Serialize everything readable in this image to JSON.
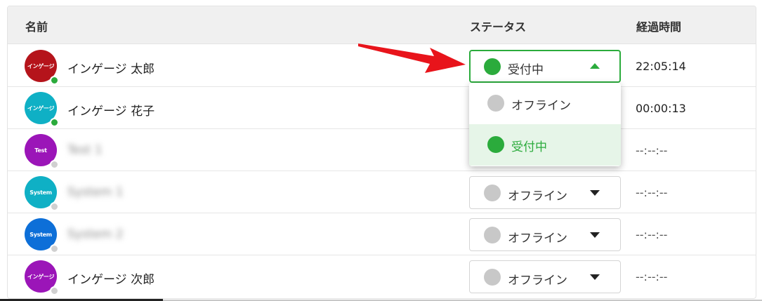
{
  "colors": {
    "online": "#2bab3c",
    "offline": "#c8c8c8",
    "header_bg": "#f0f0f0"
  },
  "table": {
    "headers": {
      "name": "名前",
      "status": "ステータス",
      "elapsed": "経過時間"
    },
    "rows": [
      {
        "avatar_text": "インゲージ",
        "avatar_color": "#b5141b",
        "online": true,
        "name": "インゲージ 太郎",
        "status": "受付中",
        "elapsed": "22:05:14"
      },
      {
        "avatar_text": "インゲージ",
        "avatar_color": "#0fb0c5",
        "online": true,
        "name": "インゲージ 花子",
        "status": "",
        "elapsed": "00:00:13"
      },
      {
        "avatar_text": "Test",
        "avatar_color": "#9b15b8",
        "online": false,
        "name": "Test 1",
        "status": "",
        "elapsed": "--:--:--"
      },
      {
        "avatar_text": "System",
        "avatar_color": "#0fb0c5",
        "online": false,
        "name": "System 1",
        "status": "オフライン",
        "elapsed": "--:--:--"
      },
      {
        "avatar_text": "System",
        "avatar_color": "#0d6fd8",
        "online": false,
        "name": "System 2",
        "status": "オフライン",
        "elapsed": "--:--:--"
      },
      {
        "avatar_text": "インゲージ",
        "avatar_color": "#9b15b8",
        "online": false,
        "name": "インゲージ 次郎",
        "status": "オフライン",
        "elapsed": "--:--:--"
      }
    ]
  },
  "dropdown": {
    "options": [
      {
        "label": "オフライン",
        "selected": false
      },
      {
        "label": "受付中",
        "selected": true
      }
    ]
  }
}
